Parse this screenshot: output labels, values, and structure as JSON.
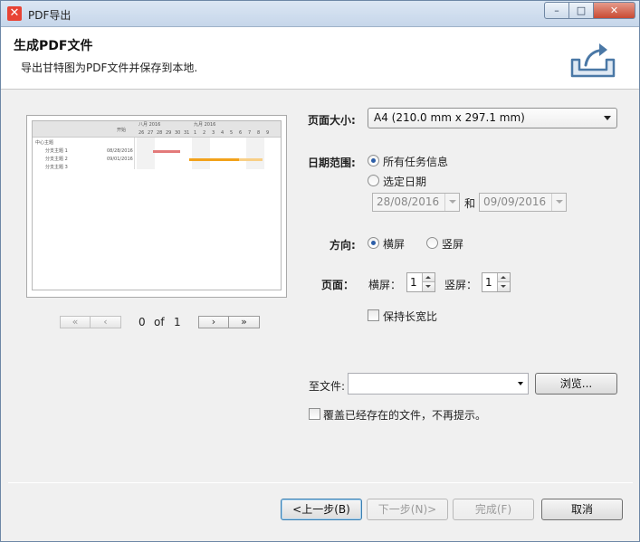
{
  "window": {
    "title": "PDF导出",
    "app_icon_glyph": "✕",
    "controls": {
      "minimize": "–",
      "maximize": "□",
      "close": "✕"
    }
  },
  "header": {
    "title": "生成PDF文件",
    "subtitle": "导出甘特图为PDF文件并保存到本地."
  },
  "preview": {
    "start_col": "开始",
    "month_1": "八月 2016",
    "month_2": "九月 2016",
    "days": [
      "26",
      "27",
      "28",
      "29",
      "30",
      "31",
      "1",
      "2",
      "3",
      "4",
      "5",
      "6",
      "7",
      "8",
      "9"
    ],
    "tasks": [
      {
        "name": "中心主题",
        "date": ""
      },
      {
        "name": "分支主题 1",
        "date": "08/28/2016"
      },
      {
        "name": "分支主题 2",
        "date": "09/01/2016"
      },
      {
        "name": "分支主题 3",
        "date": ""
      }
    ]
  },
  "pager": {
    "first": "«",
    "prev": "‹",
    "current": "0",
    "of": "of",
    "total": "1",
    "next": "›",
    "last": "»"
  },
  "form": {
    "page_size_label": "页面大小:",
    "page_size_value": "A4 (210.0 mm x 297.1 mm)",
    "date_range_label": "日期范围:",
    "all_tasks_label": "所有任务信息",
    "selected_date_label": "选定日期",
    "date_from": "28/08/2016",
    "date_and": "和",
    "date_to": "09/09/2016",
    "orientation_label": "方向:",
    "landscape_label": "横屏",
    "portrait_label": "竖屏",
    "pages_label": "页面：",
    "pages_landscape_label": "横屏：",
    "pages_landscape_value": "1",
    "pages_portrait_label": "竖屏：",
    "pages_portrait_value": "1",
    "keep_ratio_label": "保持长宽比",
    "to_file_label": "至文件:",
    "to_file_value": "",
    "browse_label": "浏览...",
    "overwrite_label": "覆盖已经存在的文件，不再提示。"
  },
  "footer": {
    "back_label": "<上一步(B)",
    "next_label": "下一步(N)>",
    "finish_label": "完成(F)",
    "cancel_label": "取消"
  },
  "colors": {
    "bar_red": "#e37a7a",
    "bar_orange": "#f2a21b",
    "bar_light_orange": "#f8cf86",
    "radio_dot": "#2c5ea8"
  }
}
